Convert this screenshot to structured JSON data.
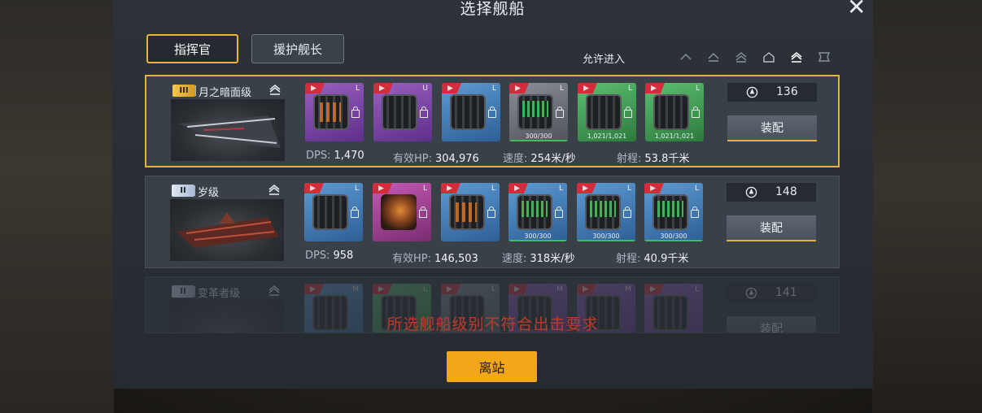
{
  "dialog": {
    "title": "选择舰船",
    "close_icon": "close-icon"
  },
  "tabs": [
    {
      "label": "指挥官",
      "active": true
    },
    {
      "label": "援护舰长",
      "active": false
    }
  ],
  "filter": {
    "label": "允许进入",
    "rank_icons": [
      "rank-1-icon",
      "rank-2-icon",
      "rank-3-icon",
      "rank-4-icon",
      "rank-5-icon",
      "rank-6-icon"
    ]
  },
  "stat_labels": {
    "dps": "DPS:",
    "hp": "有效HP:",
    "speed": "速度:",
    "range": "射程:"
  },
  "ships": [
    {
      "tier": "III",
      "name": "月之暗面级",
      "power": "136",
      "equip_label": "装配",
      "stats": {
        "dps": "1,470",
        "hp": "304,976",
        "speed": "254米/秒",
        "range": "53.8千米"
      },
      "modules": [
        {
          "color": "purple",
          "letter": "L",
          "type": "engine"
        },
        {
          "color": "purple",
          "letter": "U",
          "type": "armor"
        },
        {
          "color": "blue",
          "letter": "L",
          "type": "module"
        },
        {
          "color": "gray",
          "letter": "L",
          "type": "cannon",
          "durability": "300/300"
        },
        {
          "color": "green",
          "letter": "L",
          "type": "cannon",
          "durability": "1,021/1,021"
        },
        {
          "color": "green",
          "letter": "L",
          "type": "cannon",
          "durability": "1,021/1,021"
        }
      ]
    },
    {
      "tier": "II",
      "name": "岁级",
      "power": "148",
      "equip_label": "装配",
      "stats": {
        "dps": "958",
        "hp": "146,503",
        "speed": "318米/秒",
        "range": "40.9千米"
      },
      "modules": [
        {
          "color": "blue",
          "letter": "L",
          "type": "module"
        },
        {
          "color": "pink",
          "letter": "L",
          "type": "turret"
        },
        {
          "color": "blue",
          "letter": "L",
          "type": "engine"
        },
        {
          "color": "blue",
          "letter": "L",
          "type": "cannon",
          "durability": "300/300"
        },
        {
          "color": "blue",
          "letter": "L",
          "type": "cannon",
          "durability": "300/300"
        },
        {
          "color": "blue",
          "letter": "L",
          "type": "cannon",
          "durability": "300/300"
        }
      ]
    },
    {
      "tier": "II",
      "name": "变革者级",
      "power": "141",
      "equip_label": "装配",
      "modules": [
        {
          "color": "blue",
          "letter": "M"
        },
        {
          "color": "green",
          "letter": "L"
        },
        {
          "color": "gray",
          "letter": "L"
        },
        {
          "color": "purple",
          "letter": "M"
        },
        {
          "color": "purple",
          "letter": "M"
        },
        {
          "color": "purple",
          "letter": "L"
        }
      ]
    }
  ],
  "warning": "所选舰船级别不符合出击要求",
  "depart_label": "离站",
  "colors": {
    "accent": "#e3b43c",
    "button": "#f2a71b",
    "warning": "#c0392b"
  }
}
